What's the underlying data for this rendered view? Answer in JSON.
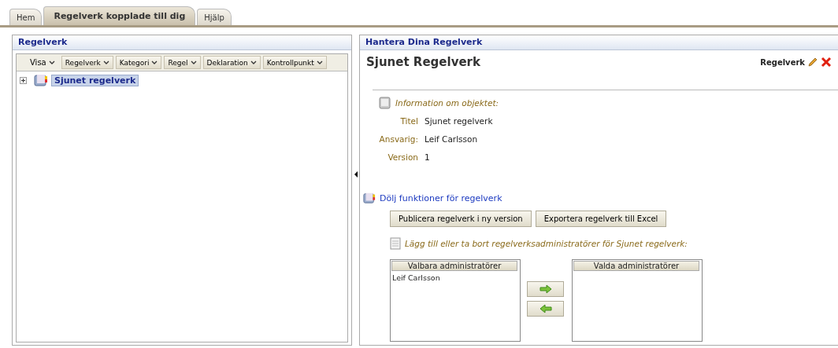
{
  "tabs": [
    {
      "label": "Hem",
      "selected": false
    },
    {
      "label": "Regelverk kopplade till dig",
      "selected": true
    },
    {
      "label": "Hjälp",
      "selected": false
    }
  ],
  "left_panel": {
    "title": "Regelverk",
    "menus": [
      "Visa",
      "Regelverk",
      "Kategori",
      "Regel",
      "Deklaration",
      "Kontrollpunkt"
    ],
    "tree": [
      {
        "label": "Sjunet regelverk",
        "selected": true,
        "expanded": false
      }
    ]
  },
  "right_panel": {
    "title": "Hantera Dina Regelverk",
    "heading": "Sjunet Regelverk",
    "action_label": "Regelverk",
    "info_title": "Information om objektet:",
    "fields": [
      {
        "label": "Titel",
        "value": "Sjunet regelverk"
      },
      {
        "label": "Ansvarig:",
        "value": "Leif Carlsson"
      },
      {
        "label": "Version",
        "value": "1"
      }
    ],
    "functions_link": "Dölj funktioner för regelverk",
    "buttons": [
      "Publicera regelverk i ny version",
      "Exportera regelverk till Excel"
    ],
    "admin_title": "Lägg till eller ta bort regelverksadministratörer för Sjunet regelverk:",
    "available": {
      "header": "Valbara administratörer",
      "items": [
        "Leif Carlsson"
      ]
    },
    "chosen": {
      "header": "Valda administratörer"
    }
  }
}
